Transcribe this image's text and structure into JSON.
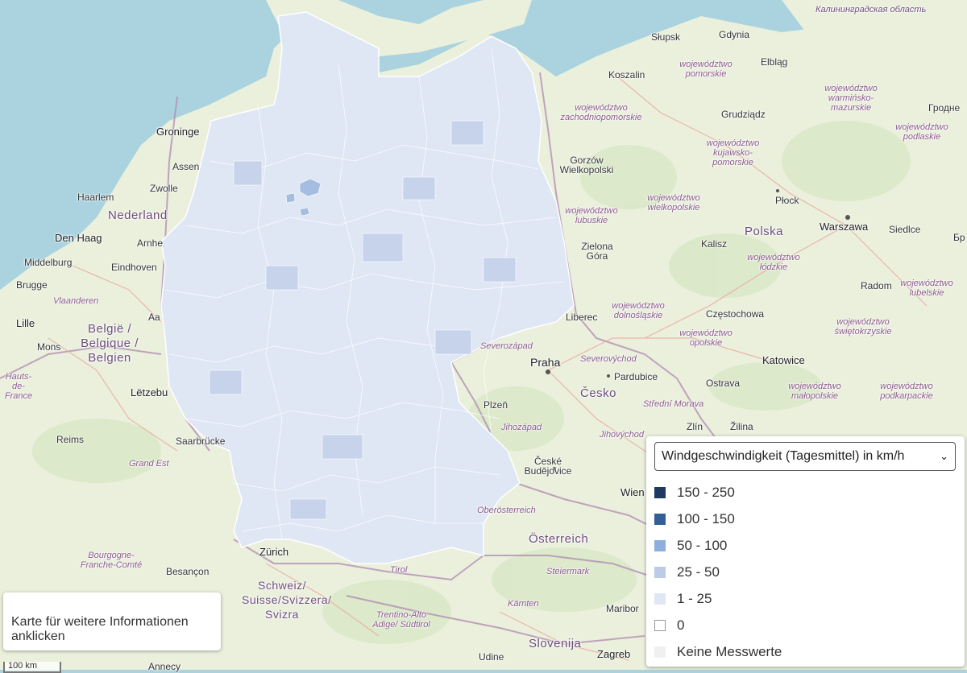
{
  "map": {
    "colors": {
      "sea": "#aad3df",
      "land": "#eaf0dc",
      "germany_fill": "#dfe6f4",
      "germany_fill_dark": "#c6d3eb",
      "germany_borders": "#ffffff",
      "accent_region": "#a5bde0"
    },
    "labels": {
      "kaliningrad": "Калининградская область",
      "grodno": "Гродне",
      "slupsk": "Słupsk",
      "gdynia": "Gdynia",
      "elblag": "Elbląg",
      "koszalin": "Koszalin",
      "pomorskie": "województwo pomorskie",
      "warminsko": "województwo warmińsko-mazurskie",
      "grudziadz": "Grudziądz",
      "podlaskie": "województwo podlaskie",
      "zachodniopomorskie": "województwo zachodniopomorskie",
      "kujawsko": "województwo kujawsko-pomorskie",
      "gorzow": "Gorzów Wielkopolski",
      "wielkopolskie": "województwo wielkopolskie",
      "plock": "Płock",
      "lubuskie": "województwo lubuskie",
      "polska": "Polska",
      "warszawa": "Warszawa",
      "siedlce": "Siedlce",
      "br": "Бр",
      "zielona": "Zielona Góra",
      "kalisz": "Kalisz",
      "lodzkie": "województwo łódzkie",
      "radom": "Radom",
      "lubelskie": "województwo lubelskie",
      "dolnoslaskie": "województwo dolnośląskie",
      "liberec": "Liberec",
      "czestochowa": "Częstochowa",
      "swietokrzyskie": "województwo świętokrzyskie",
      "opolskie": "województwo opolskie",
      "severozapad": "Severozápad",
      "praha": "Praha",
      "severovychod": "Severovýchod",
      "katowice": "Katowice",
      "pardubice": "Pardubice",
      "ostrava": "Ostrava",
      "malopolskie": "województwo małopolskie",
      "podkarpackie": "województwo podkarpackie",
      "plzen": "Plzeň",
      "cesko": "Česko",
      "strednimorava": "Střední Morava",
      "jihozapad": "Jihozápad",
      "zlin": "Zlín",
      "zilina": "Žilina",
      "jihovychod": "Jihovýchod",
      "ceske": "České Budějovice",
      "wien": "Wien",
      "oberosterreich": "Oberösterreich",
      "osterreich": "Österreich",
      "zurich": "Zürich",
      "steiermark": "Steiermark",
      "schweiz": "Schweiz/ Suisse/Svizzera/ Svizra",
      "tirol": "Tirol",
      "karnten": "Kärnten",
      "maribor": "Maribor",
      "trentino": "Trentino-Alto Adige/ Südtirol",
      "slovenija": "Slovenija",
      "udine": "Udine",
      "zagreb": "Zagreb",
      "bourgogne": "Bourgogne-Franche-Comté",
      "besancon": "Besançon",
      "grandest": "Grand Est",
      "reims": "Reims",
      "saarbrucken": "Saarbrücke",
      "letzebuerg": "Lëtzebu",
      "hautsdefrance": "Hauts-de-France",
      "lille": "Lille",
      "mons": "Mons",
      "belgie": "België / Belgique / Belgien",
      "vlaanderen": "Vlaanderen",
      "brugge": "Brugge",
      "middelburg": "Middelburg",
      "eindhoven": "Eindhoven",
      "denhaag": "Den Haag",
      "arnhem": "Arnhe",
      "nederland": "Nederland",
      "haarlem": "Haarlem",
      "zwolle": "Zwolle",
      "assen": "Assen",
      "groningen": "Groninge",
      "annecy": "Annecy",
      "aar": "Aa"
    }
  },
  "info_box": {
    "text": "Karte für weitere Informationen anklicken"
  },
  "scale_bar": {
    "label": "100 km"
  },
  "legend": {
    "select": {
      "value": "Windgeschwindigkeit (Tagesmittel) in km/h"
    },
    "entries": [
      {
        "label": "150 - 250",
        "color": "#1e3a63"
      },
      {
        "label": "100 - 150",
        "color": "#335f99"
      },
      {
        "label": "50 - 100",
        "color": "#8eaedb"
      },
      {
        "label": "25 - 50",
        "color": "#bccce8"
      },
      {
        "label": "1 - 25",
        "color": "#dfe6f4"
      },
      {
        "label": "0",
        "color": "#ffffff"
      },
      {
        "label": "Keine Messwerte",
        "color": "#f0f0f0"
      }
    ]
  }
}
